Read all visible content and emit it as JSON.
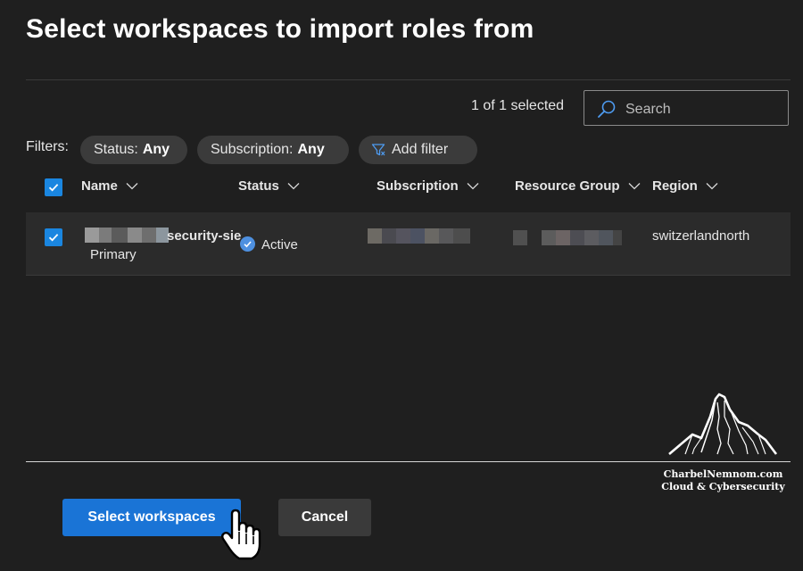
{
  "dialog": {
    "title": "Select workspaces to import roles from"
  },
  "toolbar": {
    "selected_count": "1 of 1 selected",
    "search_placeholder": "Search"
  },
  "filters": {
    "label": "Filters:",
    "status_key": "Status:",
    "status_val": "Any",
    "subscription_key": "Subscription:",
    "subscription_val": "Any",
    "add_filter": "Add filter"
  },
  "table": {
    "columns": [
      "Name",
      "Status",
      "Subscription",
      "Resource Group",
      "Region"
    ],
    "rows": [
      {
        "selected": true,
        "name_suffix": "security-sie",
        "name_sub": "Primary",
        "status": "Active",
        "subscription": "",
        "resource_group": "",
        "region": "switzerlandnorth"
      }
    ]
  },
  "footer": {
    "primary_button": "Select workspaces",
    "secondary_button": "Cancel"
  },
  "watermark": {
    "line1": "CharbelNemnom.com",
    "line2": "Cloud & Cybersecurity"
  },
  "colors": {
    "accent": "#1a74d6",
    "checkbox": "#1a86e0",
    "background": "#1f1f1f",
    "row": "#2b2b2b"
  },
  "icons": {
    "search": "search-icon",
    "filter": "filter-icon",
    "chevron": "chevron-down-icon",
    "check": "checkmark-icon",
    "cursor": "hand-pointer-icon",
    "logo": "mountain-logo"
  }
}
